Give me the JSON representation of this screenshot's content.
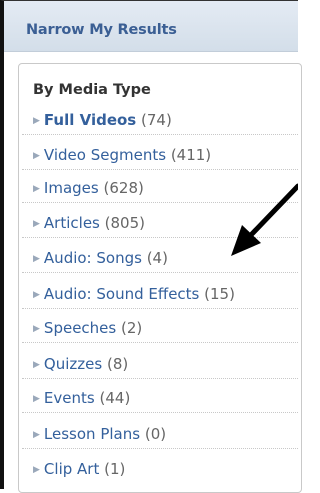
{
  "header": {
    "title": "Narrow My Results"
  },
  "section": {
    "label": "By Media Type"
  },
  "items": [
    {
      "label": "Full Videos",
      "count": "(74)",
      "bold": true
    },
    {
      "label": "Video Segments",
      "count": "(411)"
    },
    {
      "label": "Images",
      "count": "(628)"
    },
    {
      "label": "Articles",
      "count": "(805)"
    },
    {
      "label": "Audio: Songs",
      "count": "(4)"
    },
    {
      "label": "Audio: Sound Effects",
      "count": "(15)"
    },
    {
      "label": "Speeches",
      "count": "(2)"
    },
    {
      "label": "Quizzes",
      "count": "(8)"
    },
    {
      "label": "Events",
      "count": "(44)"
    },
    {
      "label": "Lesson Plans",
      "count": "(0)"
    },
    {
      "label": "Clip Art",
      "count": "(1)"
    }
  ],
  "colors": {
    "accent": "#3b5f94",
    "link": "#34609c",
    "count": "#666666"
  }
}
